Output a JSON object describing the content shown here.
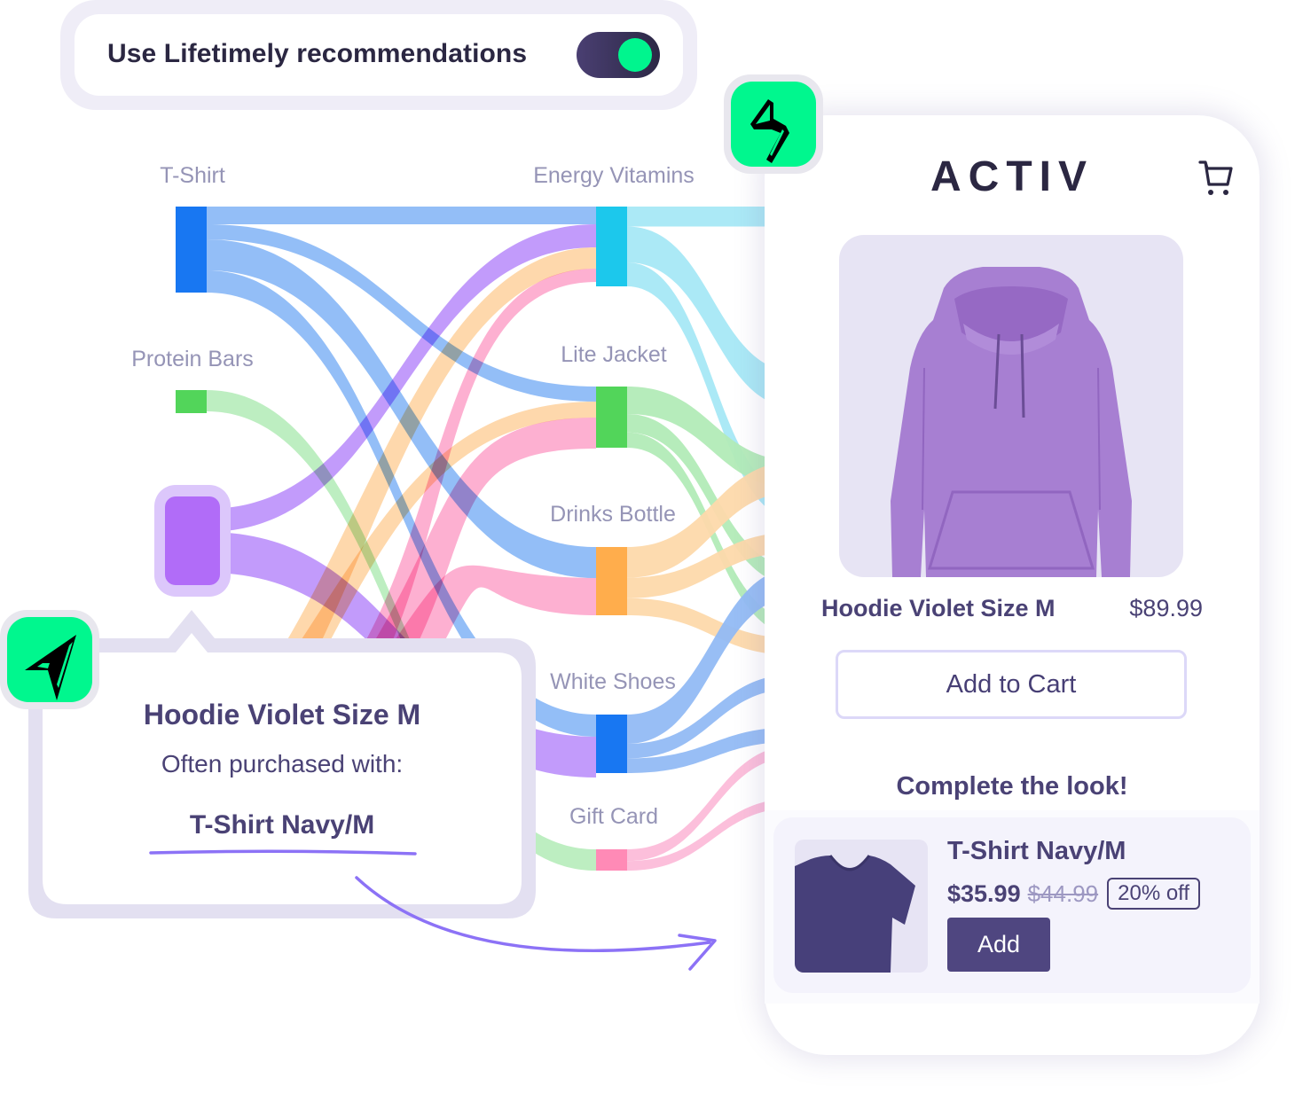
{
  "toggle": {
    "label": "Use Lifetimely recommendations",
    "state": "on",
    "track_color": "#3b3459",
    "knob_color": "#00f58e"
  },
  "chart_data": {
    "type": "sankey",
    "title": "",
    "nodes": [
      {
        "id": "tshirt",
        "label": "T-Shirt",
        "column": 0,
        "color": "#1877f2",
        "value": 97
      },
      {
        "id": "protein",
        "label": "Protein Bars",
        "column": 0,
        "color": "#52d55a",
        "value": 26
      },
      {
        "id": "hoodie",
        "label": "Hoodie Violet Size M",
        "column": 0,
        "color": "#b16cf8",
        "value": 86,
        "highlighted": true,
        "show_label": false
      },
      {
        "id": "orange_src",
        "label": "",
        "column": 0,
        "color": "#ffad4c",
        "value": 42,
        "hidden": true
      },
      {
        "id": "pink_src",
        "label": "",
        "column": 0,
        "color": "#ff8ab6",
        "value": 92,
        "hidden": true
      },
      {
        "id": "energy",
        "label": "Energy Vitamins",
        "column": 1,
        "color": "#1cc8ec",
        "value": 90
      },
      {
        "id": "jacket",
        "label": "Lite Jacket",
        "column": 1,
        "color": "#52d55a",
        "value": 69
      },
      {
        "id": "bottle",
        "label": "Drinks Bottle",
        "column": 1,
        "color": "#ffad4c",
        "value": 77
      },
      {
        "id": "shoes",
        "label": "White Shoes",
        "column": 1,
        "color": "#1877f2",
        "value": 66
      },
      {
        "id": "gift",
        "label": "Gift Card",
        "column": 1,
        "color": "#ff8ab6",
        "value": 24
      }
    ],
    "links": [
      {
        "source": "tshirt",
        "target": "energy",
        "value": 20,
        "color": "#8ab8f6"
      },
      {
        "source": "tshirt",
        "target": "jacket",
        "value": 17,
        "color": "#8ab8f6"
      },
      {
        "source": "tshirt",
        "target": "bottle",
        "value": 35,
        "color": "#8ab8f6"
      },
      {
        "source": "tshirt",
        "target": "shoes",
        "value": 25,
        "color": "#8ab8f6"
      },
      {
        "source": "protein",
        "target": "gift",
        "value": 24,
        "color": "#b7edbc"
      },
      {
        "source": "hoodie",
        "target": "energy",
        "value": 26,
        "color": "#bd92fb"
      },
      {
        "source": "hoodie",
        "target": "shoes",
        "value": 46,
        "color": "#bd92fb"
      },
      {
        "source": "orange_src",
        "target": "energy",
        "value": 24,
        "color": "#fed5a5"
      },
      {
        "source": "orange_src",
        "target": "jacket",
        "value": 18,
        "color": "#fed5a5"
      },
      {
        "source": "pink_src",
        "target": "energy",
        "value": 15,
        "color": "#fda9cd"
      },
      {
        "source": "pink_src",
        "target": "jacket",
        "value": 35,
        "color": "#fda9cd"
      },
      {
        "source": "pink_src",
        "target": "bottle",
        "value": 42,
        "color": "#fda9cd"
      }
    ],
    "outgoing_color_by_node": {
      "energy": "#a7e8f6",
      "jacket": "#b2ebb7",
      "bottle": "#fdd9ab",
      "shoes": "#92bbf4",
      "gift": "#fcbcd9"
    }
  },
  "popover": {
    "product": "Hoodie Violet Size M",
    "subtitle": "Often purchased with:",
    "recommendation": "T-Shirt Navy/M",
    "badge_icon": "navigation-arrow-icon"
  },
  "store": {
    "brand": "ACTIV",
    "cart_icon": "shopping-cart-icon",
    "badge_icon": "lightning-bolt-icon",
    "product": {
      "title": "Hoodie Violet Size M",
      "price": "$89.99",
      "image": "violet-hoodie-image",
      "add_to_cart_label": "Add to Cart"
    },
    "complete_look": {
      "heading": "Complete the look!",
      "item": {
        "title": "T-Shirt Navy/M",
        "price": "$35.99",
        "old_price": "$44.99",
        "discount": "20% off",
        "add_label": "Add",
        "image": "navy-tshirt-image"
      }
    }
  }
}
